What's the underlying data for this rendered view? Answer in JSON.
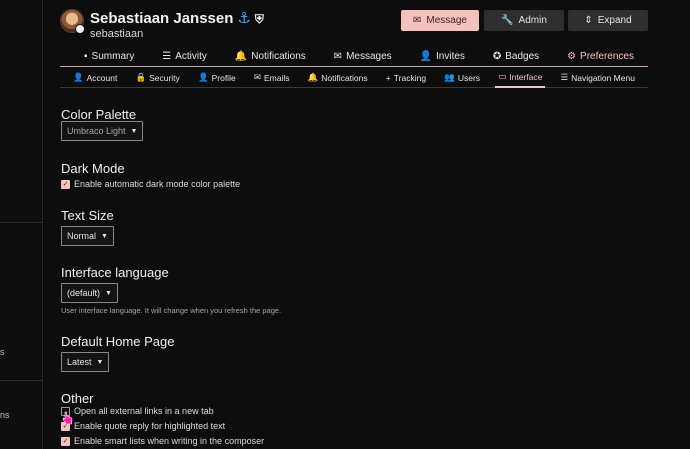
{
  "left_rail": {
    "snippet_1": "s",
    "snippet_2": "ns"
  },
  "user": {
    "name": "Sebastiaan Janssen",
    "handle": "sebastiaan",
    "flair_icon": "anchor-icon",
    "badge_icon": "shield-icon"
  },
  "actions": {
    "message": "Message",
    "admin": "Admin",
    "expand": "Expand"
  },
  "main_tabs": [
    {
      "label": "Summary",
      "icon": "summary-list-icon"
    },
    {
      "label": "Activity",
      "icon": "list-icon"
    },
    {
      "label": "Notifications",
      "icon": "bell-icon"
    },
    {
      "label": "Messages",
      "icon": "envelope-icon"
    },
    {
      "label": "Invites",
      "icon": "user-plus-icon"
    },
    {
      "label": "Badges",
      "icon": "badge-icon"
    },
    {
      "label": "Preferences",
      "icon": "gear-icon",
      "active": true
    }
  ],
  "pref_tabs": [
    {
      "label": "Account",
      "icon": "user-icon"
    },
    {
      "label": "Security",
      "icon": "lock-icon"
    },
    {
      "label": "Profile",
      "icon": "user-icon"
    },
    {
      "label": "Emails",
      "icon": "envelope-icon"
    },
    {
      "label": "Notifications",
      "icon": "bell-icon"
    },
    {
      "label": "Tracking",
      "icon": "plus-icon"
    },
    {
      "label": "Users",
      "icon": "users-icon"
    },
    {
      "label": "Interface",
      "icon": "desktop-icon",
      "active": true
    },
    {
      "label": "Navigation Menu",
      "icon": "bars-icon"
    }
  ],
  "sections": {
    "color_palette": {
      "title": "Color Palette",
      "value": "Umbraco Light"
    },
    "dark_mode": {
      "title": "Dark Mode",
      "checkbox": "Enable automatic dark mode color palette",
      "checked": true
    },
    "text_size": {
      "title": "Text Size",
      "value": "Normal"
    },
    "interface_language": {
      "title": "Interface language",
      "value": "(default)",
      "help": "User interface language. It will change when you refresh the page."
    },
    "default_home": {
      "title": "Default Home Page",
      "value": "Latest"
    },
    "other": {
      "title": "Other",
      "options": [
        {
          "label": "Open all external links in a new tab",
          "checked": false
        },
        {
          "label": "Enable quote reply for highlighted text",
          "checked": true
        },
        {
          "label": "Enable smart lists when writing in the composer",
          "checked": true
        }
      ]
    }
  },
  "colors": {
    "accent": "#f5c2c0",
    "background": "#0d0d0d",
    "button_dark": "#2f2f2f",
    "cursor": "#ff1fb2"
  }
}
